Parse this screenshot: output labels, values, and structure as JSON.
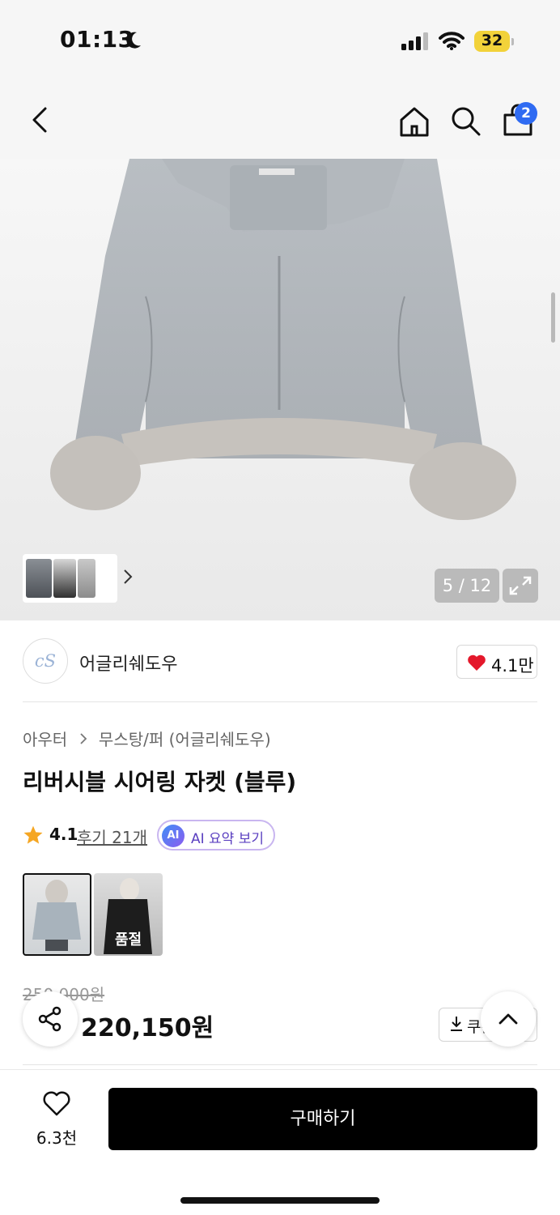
{
  "status_bar": {
    "time": "01:13",
    "battery": "32"
  },
  "header": {
    "cart_count": "2"
  },
  "gallery": {
    "page_counter": "5 / 12"
  },
  "brand": {
    "logo_text": "cS",
    "name": "어글리쉐도우",
    "like_count": "4.1만"
  },
  "breadcrumb": {
    "level1": "아우터",
    "level2": "무스탕/퍼 (어글리쉐도우)"
  },
  "product": {
    "title": "리버시블 시어링 자켓 (블루)",
    "rating": "4.1",
    "review_link": "후기 21개",
    "ai_badge": "AI",
    "ai_summary_label": "AI 요약 보기",
    "variant_soldout_label": "품절",
    "original_price": "250,000원",
    "sale_price": "220,150원",
    "coupon_label": "쿠폰"
  },
  "bottom_bar": {
    "wish_count": "6.3천",
    "buy_label": "구매하기"
  },
  "colors": {
    "accent_blue": "#2f6bf2",
    "heart_red": "#e4182b",
    "star_orange": "#f5a623",
    "buy_button": "#000000"
  }
}
